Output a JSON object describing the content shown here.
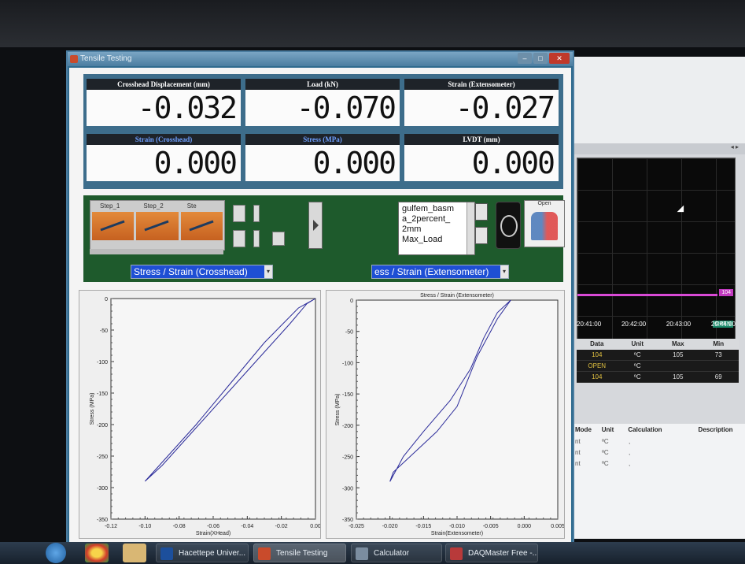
{
  "window": {
    "title": "Tensile Testing"
  },
  "readouts": [
    {
      "label": "Crosshead Displacement (mm)",
      "value": "-0.032"
    },
    {
      "label": "Load (kN)",
      "value": "-0.070"
    },
    {
      "label": "Strain (Extensometer)",
      "value": "-0.027"
    },
    {
      "label": "Strain (Crosshead)",
      "value": "0.000"
    },
    {
      "label": "Stress (MPa)",
      "value": "0.000"
    },
    {
      "label": "LVDT (mm)",
      "value": "0.000"
    }
  ],
  "steps": {
    "labels": [
      "Step_1",
      "Step_2",
      "Ste"
    ]
  },
  "method_list": [
    "gulfem_basm",
    "a_2percent_",
    "2mm",
    "Max_Load"
  ],
  "open_button": {
    "label": "Open"
  },
  "dropdown_left": {
    "value": "Stress / Strain (Crosshead)"
  },
  "dropdown_right": {
    "value": "ess / Strain (Extensometer)"
  },
  "charts": {
    "left": {
      "xlabel": "Strain(XHead)",
      "ylabel": "Stress (MPa)",
      "xticks": [
        "-0.12",
        "-0.10",
        "-0.08",
        "-0.06",
        "-0.04",
        "-0.02",
        "0.00"
      ],
      "yticks": [
        "0",
        "-50",
        "-100",
        "-150",
        "-200",
        "-250",
        "-300",
        "-350"
      ]
    },
    "right": {
      "title": "Stress / Strain (Extensometer)",
      "xlabel": "Strain(Extensometer)",
      "ylabel": "Stress (MPa)",
      "xticks": [
        "-0.025",
        "-0.020",
        "-0.015",
        "-0.010",
        "-0.005",
        "0.000",
        "0.005"
      ],
      "yticks": [
        "0",
        "-50",
        "-100",
        "-150",
        "-200",
        "-250",
        "-300",
        "-350"
      ]
    }
  },
  "chart_data": [
    {
      "type": "line",
      "title": "",
      "xlabel": "Strain(XHead)",
      "ylabel": "Stress (MPa)",
      "xlim": [
        -0.12,
        0.0
      ],
      "ylim": [
        -350,
        0
      ],
      "series": [
        {
          "x": [
            0.0,
            -0.01,
            -0.03,
            -0.05,
            -0.07,
            -0.085,
            -0.1,
            -0.09,
            -0.07,
            -0.05,
            -0.03,
            -0.015,
            -0.005,
            0.0
          ],
          "y": [
            0,
            -15,
            -70,
            -135,
            -200,
            -245,
            -290,
            -265,
            -205,
            -145,
            -85,
            -40,
            -8,
            0
          ]
        }
      ]
    },
    {
      "type": "line",
      "title": "Stress / Strain (Extensometer)",
      "xlabel": "Strain(Extensometer)",
      "ylabel": "Stress (MPa)",
      "xlim": [
        -0.025,
        0.005
      ],
      "ylim": [
        -350,
        0
      ],
      "series": [
        {
          "x": [
            -0.002,
            -0.004,
            -0.006,
            -0.008,
            -0.011,
            -0.015,
            -0.018,
            -0.02,
            -0.0195,
            -0.016,
            -0.013,
            -0.01,
            -0.007,
            -0.004,
            -0.002
          ],
          "y": [
            0,
            -20,
            -60,
            -110,
            -160,
            -210,
            -250,
            -290,
            -275,
            -240,
            -210,
            -170,
            -90,
            -30,
            0
          ]
        }
      ]
    }
  ],
  "daq": {
    "times": [
      "20:41:00",
      "20:42:00",
      "20:43:00",
      "20:44:00"
    ],
    "tags": [
      "104",
      "OPEN"
    ],
    "table_headers": [
      "Data",
      "Unit",
      "Max",
      "Min"
    ],
    "table_rows": [
      [
        "104",
        "ºC",
        "105",
        "73"
      ],
      [
        "OPEN",
        "ºC",
        "",
        ""
      ],
      [
        "104",
        "ºC",
        "105",
        "69"
      ]
    ],
    "table2_headers": [
      "Mode",
      "Unit",
      "Calculation",
      "Description"
    ],
    "table2_rows": [
      [
        "nt",
        "ºC",
        ","
      ],
      [
        "nt",
        "ºC",
        ","
      ],
      [
        "nt",
        "ºC",
        ","
      ]
    ]
  },
  "taskbar": {
    "tasks": [
      "Hacettepe Univer...",
      "Tensile Testing",
      "Calculator",
      "DAQMaster Free -..."
    ]
  },
  "colors": {
    "curve": "#2b2b9a",
    "panel_green": "#1e5a2c",
    "readout_frame": "#3d6d8b",
    "dropdown_blue": "#1e4fd4"
  }
}
